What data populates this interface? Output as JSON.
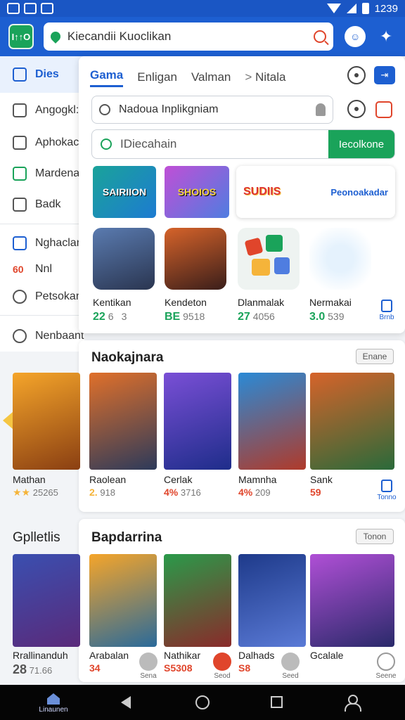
{
  "status_bar": {
    "time": "1239"
  },
  "app_bar": {
    "logo_text": "I↑↑O",
    "search_query": "Kiecandii Kuoclikan"
  },
  "sidebar": {
    "active_item": "Dies",
    "items": [
      "Angogkl:",
      "Aphokac",
      "Mardena",
      "Badk",
      "Nghaclanp",
      "Nnl",
      "Petsokan",
      "Nenbaant"
    ],
    "badge": "60"
  },
  "panel": {
    "tabs": [
      "Gama",
      "Enligan",
      "Valman",
      "Nitala"
    ],
    "tab_prefix": ">",
    "field_name": "Nadoua Inplikgniam",
    "search_placeholder": "IDiecahain",
    "search_button": "Iecolkone",
    "promo_text": "Peonoakadar",
    "banners": [
      "SAIRIION",
      "SHOIOS",
      "SUDIIS"
    ],
    "tiles": [
      {
        "name": "Kentikan",
        "rating": "22",
        "count": "63"
      },
      {
        "name": "Kendeton",
        "rating": "BE",
        "count": "9518"
      },
      {
        "name": "Dlanmalak",
        "rating": "27",
        "count": "4056"
      },
      {
        "name": "Nermakai",
        "rating": "3.0",
        "count": "539"
      }
    ],
    "side_action_label": "Brnb"
  },
  "section1": {
    "title": "Naokajnara",
    "chip": "Enane",
    "cards": [
      {
        "name": "Mathan",
        "rating": "★★",
        "count": "25265"
      },
      {
        "name": "Raolean",
        "rating": "2.",
        "count": "918"
      },
      {
        "name": "Cerlak",
        "rating": "4%",
        "count": "3716"
      },
      {
        "name": "Mamnha",
        "rating": "4%",
        "count": "209"
      },
      {
        "name": "Sank",
        "rating": "59",
        "count": ""
      }
    ],
    "side_action_label": "Tonno"
  },
  "section2": {
    "left_heading": "Gplletlis",
    "title": "Bapdarrina",
    "chip": "Tonon",
    "cards": [
      {
        "name": "Rrallinanduh",
        "rating": "28",
        "count": "71.66"
      },
      {
        "name": "Arabalan",
        "rating": "34",
        "count": ""
      },
      {
        "name": "Nathikar",
        "rating": "",
        "count": "S5308"
      },
      {
        "name": "Dalhads",
        "rating": "S8",
        "count": ""
      },
      {
        "name": "Gcalale",
        "rating": "",
        "count": ""
      }
    ],
    "action_labels": [
      "Sena",
      "Seod",
      "Seed",
      "Seene"
    ]
  },
  "nav_bar": {
    "home_label": "Linaunen"
  },
  "colors": {
    "primary": "#1d5fd1",
    "accent_green": "#1aa35a",
    "accent_red": "#e0452b"
  }
}
